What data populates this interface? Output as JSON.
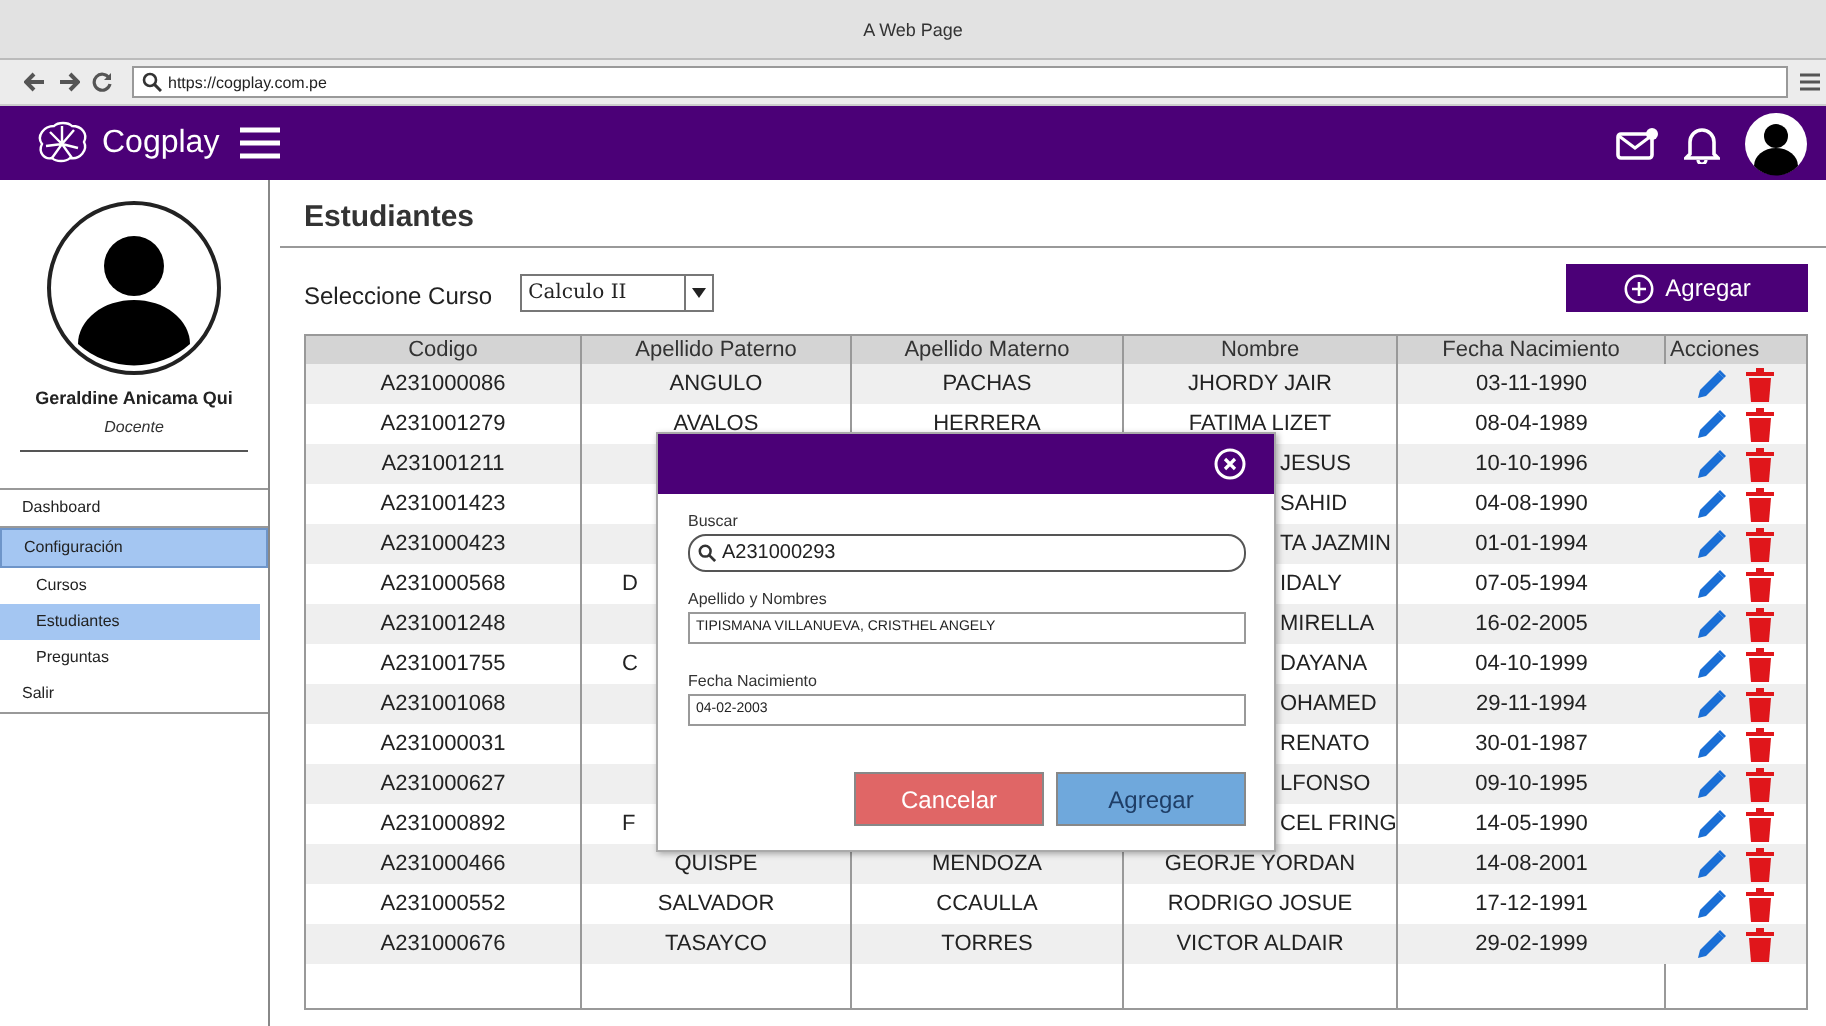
{
  "browser": {
    "title": "A Web Page",
    "url": "https://cogplay.com.pe"
  },
  "app_header": {
    "logo_text": "Cogplay"
  },
  "sidebar": {
    "user_name": "Geraldine Anicama Qui",
    "role": "Docente",
    "menu": [
      {
        "label": "Dashboard",
        "selected": false
      },
      {
        "label": "Configuración",
        "selected": true,
        "children": [
          {
            "label": "Cursos",
            "selected": false
          },
          {
            "label": "Estudiantes",
            "selected": true
          },
          {
            "label": "Preguntas",
            "selected": false
          }
        ]
      },
      {
        "label": "Salir",
        "selected": false
      }
    ]
  },
  "page": {
    "title": "Estudiantes",
    "course_label": "Seleccione Curso",
    "course_value": "Calculo II",
    "add_button": "Agregar"
  },
  "table": {
    "columns": [
      "Codigo",
      "Apellido Paterno",
      "Apellido Materno",
      "Nombre",
      "Fecha Nacimiento",
      "Acciones"
    ],
    "rows": [
      {
        "codigo": "A231000086",
        "paterno": "ANGULO",
        "materno": "PACHAS",
        "nombre": "JHORDY JAIR",
        "fecha": "03-11-1990",
        "hidden_by_dialog": false
      },
      {
        "codigo": "A231001279",
        "paterno": "AVALOS",
        "materno": "HERRERA",
        "nombre": "FATIMA LIZET",
        "fecha": "08-04-1989",
        "hidden_by_dialog": false
      },
      {
        "codigo": "A231001211",
        "nombre": "JESUS",
        "fecha": "10-10-1996",
        "hidden_by_dialog": true
      },
      {
        "codigo": "A231001423",
        "nombre": "SAHID",
        "fecha": "04-08-1990",
        "hidden_by_dialog": true
      },
      {
        "codigo": "A231000423",
        "nombre": "TA JAZMIN",
        "fecha": "01-01-1994",
        "hidden_by_dialog": true
      },
      {
        "codigo": "A231000568",
        "paterno": "D",
        "nombre": "IDALY",
        "fecha": "07-05-1994",
        "hidden_by_dialog": true
      },
      {
        "codigo": "A231001248",
        "nombre": "MIRELLA",
        "fecha": "16-02-2005",
        "hidden_by_dialog": true
      },
      {
        "codigo": "A231001755",
        "paterno": "C",
        "nombre": "DAYANA",
        "fecha": "04-10-1999",
        "hidden_by_dialog": true
      },
      {
        "codigo": "A231001068",
        "nombre": "OHAMED",
        "fecha": "29-11-1994",
        "hidden_by_dialog": true
      },
      {
        "codigo": "A231000031",
        "nombre": "RENATO",
        "fecha": "30-01-1987",
        "hidden_by_dialog": true
      },
      {
        "codigo": "A231000627",
        "nombre": "LFONSO",
        "fecha": "09-10-1995",
        "hidden_by_dialog": true
      },
      {
        "codigo": "A231000892",
        "paterno": "F",
        "nombre": "CEL FRING",
        "fecha": "14-05-1990",
        "hidden_by_dialog": true
      },
      {
        "codigo": "A231000466",
        "paterno": "QUISPE",
        "materno": "MENDOZA",
        "nombre": "GEORJE YORDAN",
        "fecha": "14-08-2001",
        "hidden_by_dialog": false
      },
      {
        "codigo": "A231000552",
        "paterno": "SALVADOR",
        "materno": "CCAULLA",
        "nombre": "RODRIGO JOSUE",
        "fecha": "17-12-1991",
        "hidden_by_dialog": false
      },
      {
        "codigo": "A231000676",
        "paterno": "TASAYCO",
        "materno": "TORRES",
        "nombre": "VICTOR ALDAIR",
        "fecha": "29-02-1999",
        "hidden_by_dialog": false
      }
    ]
  },
  "dialog": {
    "search_label": "Buscar",
    "search_value": "A231000293",
    "name_label": "Apellido y Nombres",
    "name_value": "TIPISMANA VILLANUEVA, CRISTHEL ANGELY",
    "date_label": "Fecha Nacimiento",
    "date_value": "04-02-2003",
    "buttons": [
      {
        "label": "Cancelar",
        "kind": "cancel"
      },
      {
        "label": "Agregar",
        "kind": "primary"
      }
    ]
  }
}
